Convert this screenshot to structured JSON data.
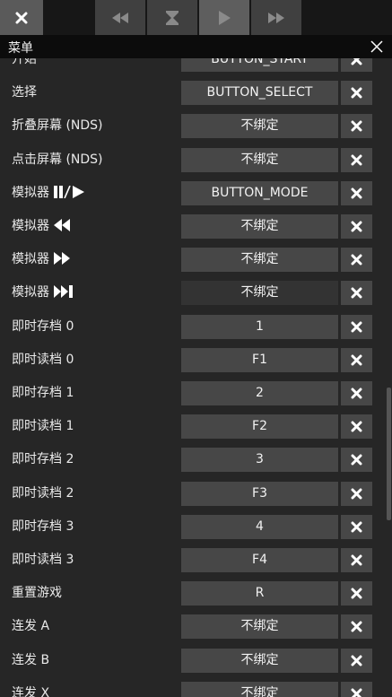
{
  "toolbar": {
    "buttons": [
      {
        "name": "close-icon"
      },
      {
        "name": "rewind-icon"
      },
      {
        "name": "hourglass-icon"
      },
      {
        "name": "play-icon"
      },
      {
        "name": "fast-forward-icon"
      }
    ]
  },
  "menu": {
    "title": "菜单"
  },
  "rows": [
    {
      "label": "开始",
      "value": "BUTTON_START"
    },
    {
      "label": "选择",
      "value": "BUTTON_SELECT"
    },
    {
      "label": "折叠屏幕 (NDS)",
      "value": "不绑定"
    },
    {
      "label": "点击屏幕 (NDS)",
      "value": "不绑定"
    },
    {
      "label": "模拟器",
      "icon": "pause-play-icon",
      "value": "BUTTON_MODE"
    },
    {
      "label": "模拟器",
      "icon": "rewind-icon",
      "value": "不绑定"
    },
    {
      "label": "模拟器",
      "icon": "fast-forward-icon",
      "value": "不绑定"
    },
    {
      "label": "模拟器",
      "icon": "skip-forward-icon",
      "value": "不绑定",
      "selected": true
    },
    {
      "label": "即时存档 0",
      "value": "1"
    },
    {
      "label": "即时读档 0",
      "value": "F1"
    },
    {
      "label": "即时存档 1",
      "value": "2"
    },
    {
      "label": "即时读档 1",
      "value": "F2"
    },
    {
      "label": "即时存档 2",
      "value": "3"
    },
    {
      "label": "即时读档 2",
      "value": "F3"
    },
    {
      "label": "即时存档 3",
      "value": "4"
    },
    {
      "label": "即时读档 3",
      "value": "F4"
    },
    {
      "label": "重置游戏",
      "value": "R"
    },
    {
      "label": "连发 A",
      "value": "不绑定"
    },
    {
      "label": "连发 B",
      "value": "不绑定"
    },
    {
      "label": "连发 X",
      "value": "不绑定"
    }
  ]
}
